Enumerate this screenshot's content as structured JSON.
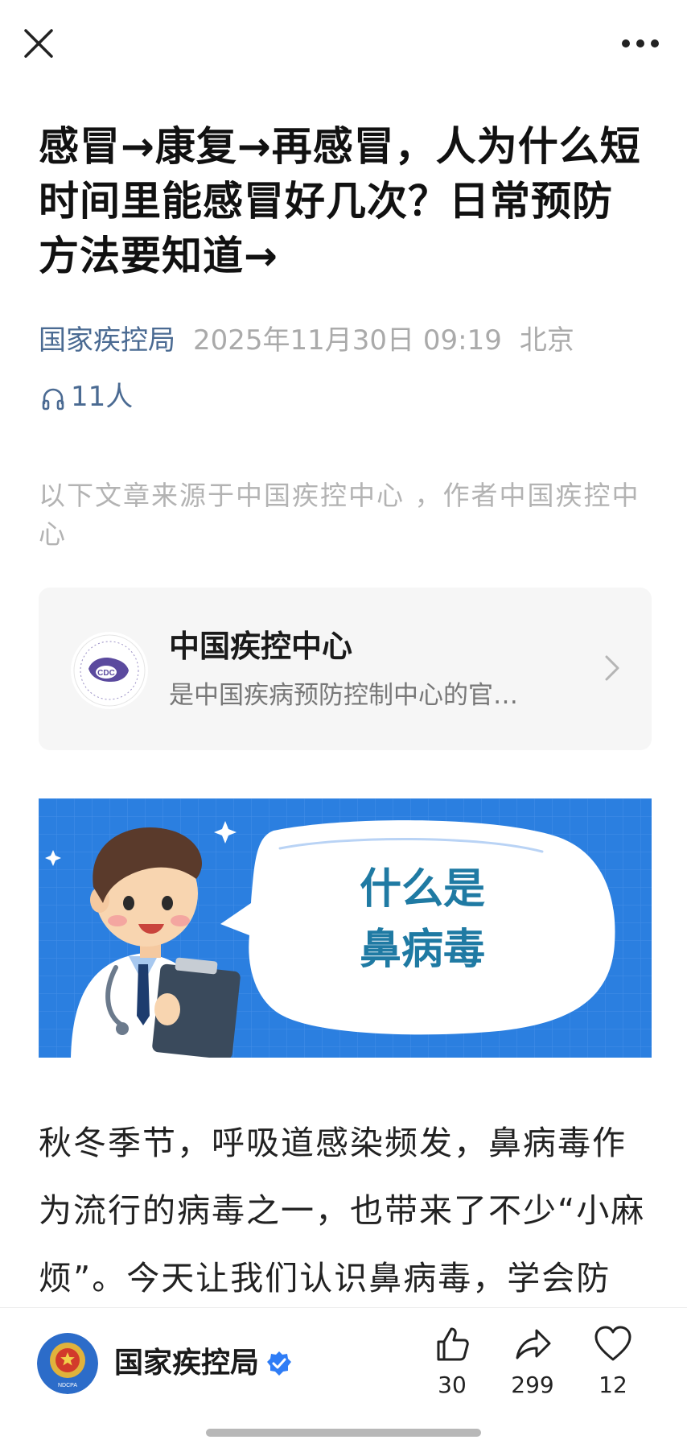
{
  "header": {
    "close_icon": "close-icon",
    "more_icon": "more-horizontal-icon"
  },
  "article": {
    "title": "感冒→康复→再感冒，人为什么短时间里能感冒好几次？日常预防方法要知道→",
    "author": "国家疾控局",
    "datetime": "2025年11月30日 09:19",
    "location": "北京",
    "listeners": "11人",
    "source_note": "以下文章来源于中国疾控中心 ，作者中国疾控中心",
    "body": "秋冬季节，呼吸道感染频发，鼻病毒作为流行的病毒之一，也带来了不少“小麻烦”。今天让我们认识鼻病毒，学会防"
  },
  "account_card": {
    "name": "中国疾控中心",
    "description": "是中国疾病预防控制中心的官…",
    "logo_text": "CDC"
  },
  "banner": {
    "line1": "什么是",
    "line2": "鼻病毒"
  },
  "bottom_bar": {
    "account_name": "国家疾控局",
    "badge_text": "NDCPA",
    "likes": "30",
    "shares": "299",
    "favorites": "12"
  },
  "colors": {
    "author_blue": "#4a6a92",
    "banner_blue": "#2b7fe0",
    "verified_blue": "#2f7df6"
  }
}
